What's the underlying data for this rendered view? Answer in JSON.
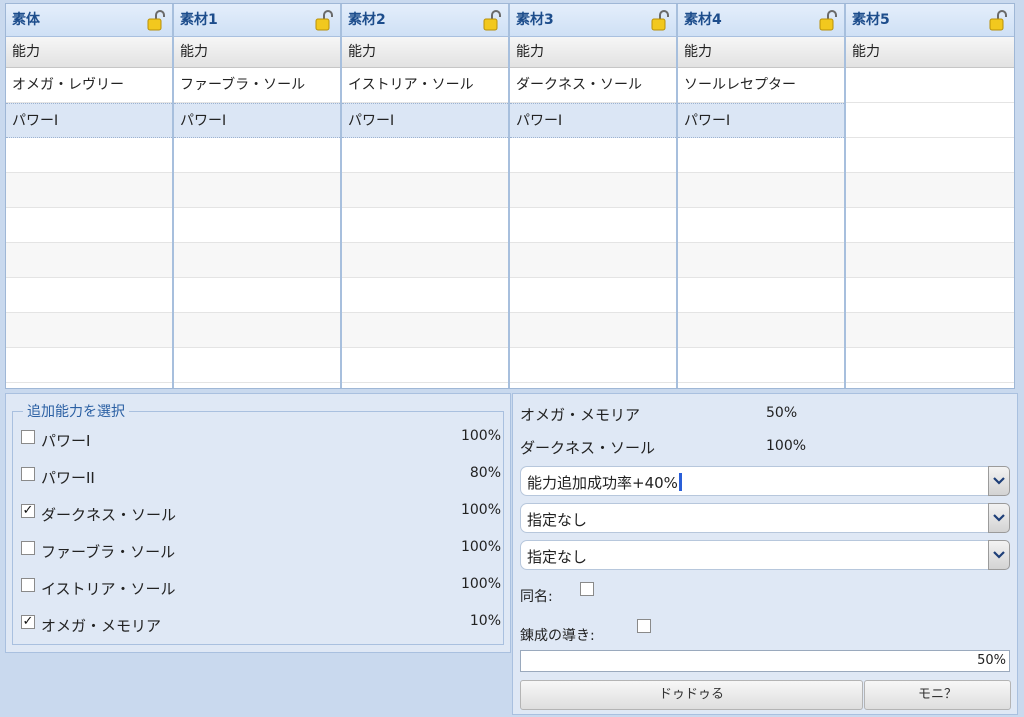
{
  "grid": {
    "columns": [
      {
        "header": "素体",
        "sub": "能力",
        "items": [
          "オメガ・レヴリー",
          "パワーI"
        ]
      },
      {
        "header": "素材1",
        "sub": "能力",
        "items": [
          "ファーブラ・ソール",
          "パワーI"
        ]
      },
      {
        "header": "素材2",
        "sub": "能力",
        "items": [
          "イストリア・ソール",
          "パワーI"
        ]
      },
      {
        "header": "素材3",
        "sub": "能力",
        "items": [
          "ダークネス・ソール",
          "パワーI"
        ]
      },
      {
        "header": "素材4",
        "sub": "能力",
        "items": [
          "ソールレセプター",
          "パワーI"
        ]
      },
      {
        "header": "素材5",
        "sub": "能力",
        "items": [
          "",
          ""
        ]
      }
    ]
  },
  "abilities": {
    "legend": "追加能力を選択",
    "items": [
      {
        "label": "パワーI",
        "percent": "100%",
        "checked": false
      },
      {
        "label": "パワーII",
        "percent": "80%",
        "checked": false
      },
      {
        "label": "ダークネス・ソール",
        "percent": "100%",
        "checked": true
      },
      {
        "label": "ファーブラ・ソール",
        "percent": "100%",
        "checked": false
      },
      {
        "label": "イストリア・ソール",
        "percent": "100%",
        "checked": false
      },
      {
        "label": "オメガ・メモリア",
        "percent": "10%",
        "checked": true
      }
    ]
  },
  "summary": {
    "items": [
      {
        "label": "オメガ・メモリア",
        "percent": "50%"
      },
      {
        "label": "ダークネス・ソール",
        "percent": "100%"
      }
    ],
    "selects": [
      "能力追加成功率+40%",
      "指定なし",
      "指定なし"
    ],
    "same_name_label": "同名:",
    "guidance_label": "錬成の導き:",
    "progress_value": 50,
    "progress_text": "50%",
    "button_left": "ドゥドゥる",
    "button_right": "モニ？"
  }
}
